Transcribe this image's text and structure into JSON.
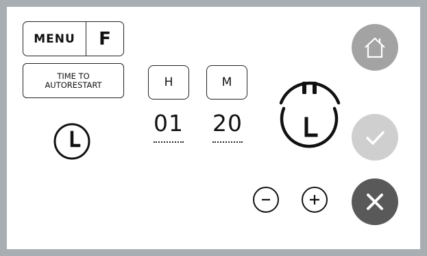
{
  "menu": {
    "label": "MENU",
    "shortcut": "F"
  },
  "time_to_autorestart": {
    "label": "TIME TO\nAUTORESTART"
  },
  "hours": {
    "label": "H",
    "value": "01"
  },
  "minutes": {
    "label": "M",
    "value": "20"
  },
  "icons": {
    "clock": "clock-icon",
    "pause": "pause-icon",
    "home": "home-icon",
    "check": "check-icon",
    "close": "close-icon",
    "minus": "minus-icon",
    "plus": "plus-icon"
  },
  "colors": {
    "frame": "#a9aeb3",
    "home_button": "#a3a3a3",
    "confirm_button": "#cfcfcf",
    "cancel_button": "#595959"
  }
}
